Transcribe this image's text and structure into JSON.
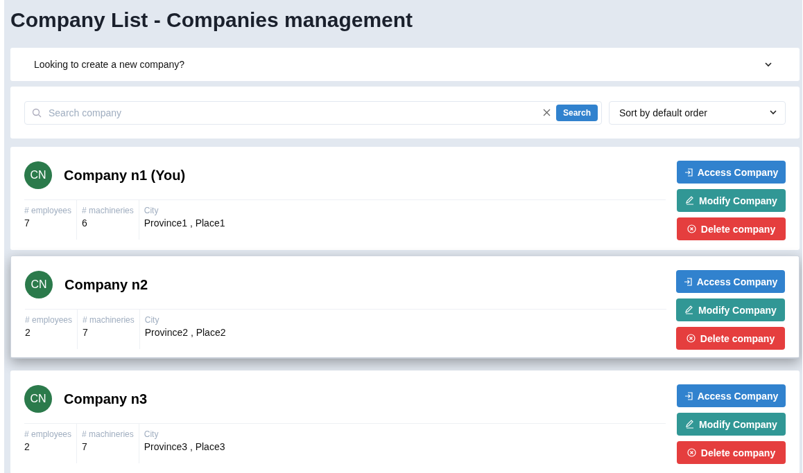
{
  "page": {
    "title": "Company List - Companies management"
  },
  "create_panel": {
    "label": "Looking to create a new company?",
    "expanded": false
  },
  "search": {
    "placeholder": "Search company",
    "button": "Search",
    "sort": "Sort by default order"
  },
  "companies": [
    {
      "avatar": "CN",
      "name": "Company n1 (You)",
      "hovered": false,
      "stats": [
        {
          "label": "# employees",
          "value": "7"
        },
        {
          "label": "# machineries",
          "value": "6"
        },
        {
          "label": "City",
          "value": "Province1 , Place1"
        }
      ],
      "actions": [
        {
          "kind": "access",
          "label": "Access Company"
        },
        {
          "kind": "modify",
          "label": "Modify Company"
        },
        {
          "kind": "delete",
          "label": "Delete company"
        }
      ]
    },
    {
      "avatar": "CN",
      "name": "Company n2",
      "hovered": true,
      "stats": [
        {
          "label": "# employees",
          "value": "2"
        },
        {
          "label": "# machineries",
          "value": "7"
        },
        {
          "label": "City",
          "value": "Province2 , Place2"
        }
      ],
      "actions": [
        {
          "kind": "access",
          "label": "Access Company"
        },
        {
          "kind": "modify",
          "label": "Modify Company"
        },
        {
          "kind": "delete",
          "label": "Delete company"
        }
      ]
    },
    {
      "avatar": "CN",
      "name": "Company n3",
      "hovered": false,
      "stats": [
        {
          "label": "# employees",
          "value": "2"
        },
        {
          "label": "# machineries",
          "value": "7"
        },
        {
          "label": "City",
          "value": "Province3 , Place3"
        }
      ],
      "actions": [
        {
          "kind": "access",
          "label": "Access Company"
        },
        {
          "kind": "modify",
          "label": "Modify Company"
        },
        {
          "kind": "delete",
          "label": "Delete company"
        }
      ]
    }
  ]
}
